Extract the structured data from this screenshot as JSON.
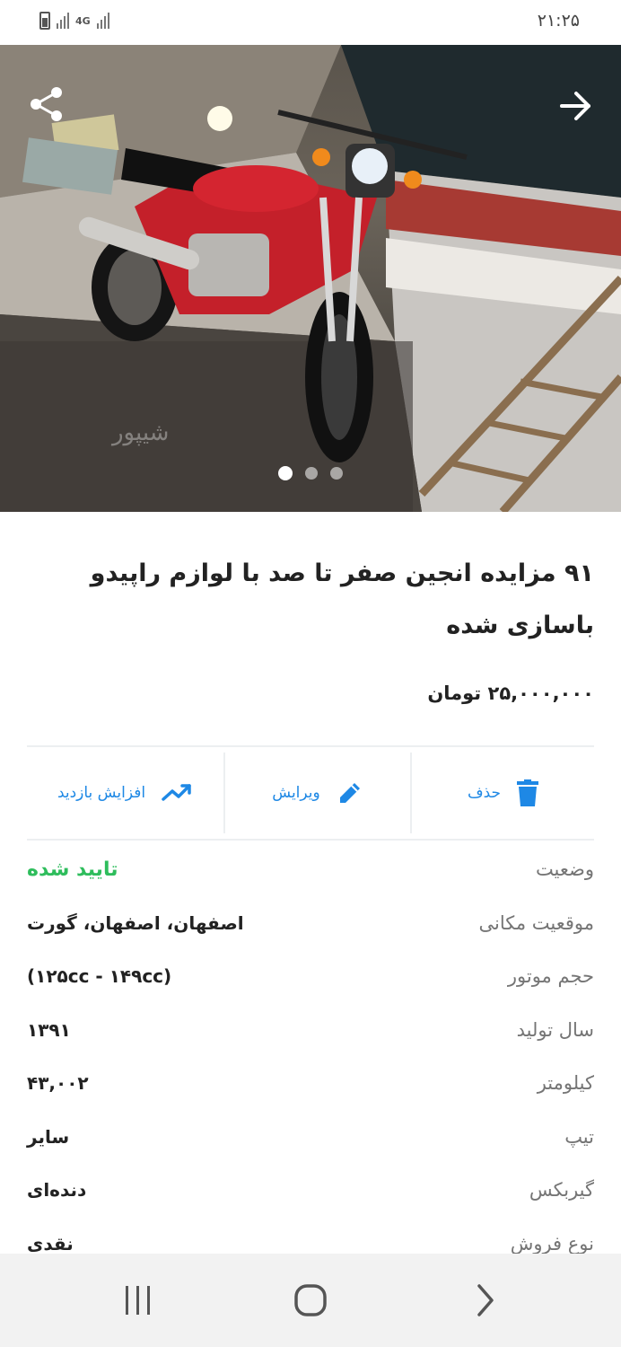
{
  "status_bar": {
    "time": "۲۱:۲۵",
    "network": "4G",
    "icons": [
      "battery-icon",
      "signal-icon",
      "network-4g-icon",
      "signal-icon"
    ]
  },
  "gallery": {
    "image_description_icon": "motorcycle-photo",
    "watermark": "شیپور",
    "total_images": 3,
    "current_index": 1,
    "icons": {
      "share": "share-icon",
      "next": "arrow-right-icon"
    }
  },
  "listing": {
    "title": "۹۱ مزایده انجین صفر تا صد با لوازم راپیدو باسازی شده",
    "price": "۲۵,۰۰۰,۰۰۰ تومان"
  },
  "actions": [
    {
      "label": "حذف",
      "icon": "trash-icon"
    },
    {
      "label": "ویرایش",
      "icon": "pencil-icon"
    },
    {
      "label": "افزایش بازدید",
      "icon": "trending-up-icon"
    }
  ],
  "details": [
    {
      "label": "وضعیت",
      "value": "تایید شده"
    },
    {
      "label": "موقعیت مکانی",
      "value": "اصفهان، اصفهان، گورت"
    },
    {
      "label": "حجم موتور",
      "value": "(۱۲۵cc - ۱۴۹cc)"
    },
    {
      "label": "سال تولید",
      "value": "۱۳۹۱"
    },
    {
      "label": "کیلومتر",
      "value": "۴۳,۰۰۲"
    },
    {
      "label": "تیپ",
      "value": "سایر"
    },
    {
      "label": "گیربکس",
      "value": "دنده‌ای"
    },
    {
      "label": "نوع فروش",
      "value": "نقدی"
    }
  ],
  "colors": {
    "accent": "#1e88e5",
    "status_ok": "#2ebd5c",
    "label_gray": "#757575",
    "nav_bar": "#f2f2f2"
  },
  "nav_bar": {
    "icons": [
      "recent-apps-icon",
      "home-icon",
      "back-icon"
    ]
  }
}
